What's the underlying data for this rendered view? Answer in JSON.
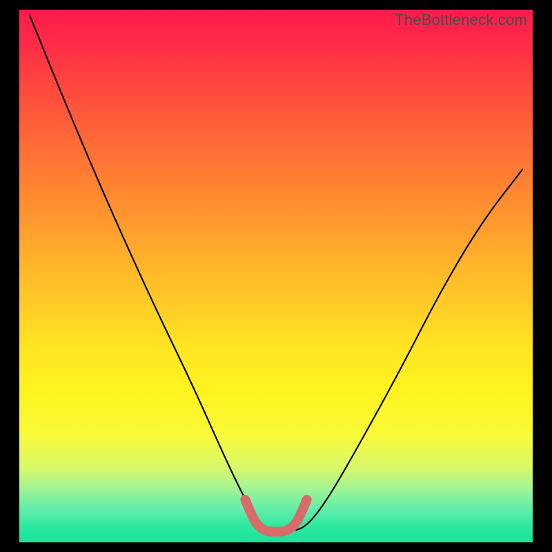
{
  "watermark": "TheBottleneck.com",
  "chart_data": {
    "type": "line",
    "title": "",
    "xlabel": "",
    "ylabel": "",
    "xlim": [
      0,
      100
    ],
    "ylim": [
      0,
      100
    ],
    "grid": false,
    "series": [
      {
        "name": "bottleneck-curve",
        "color": "#000000",
        "x": [
          2,
          10,
          18,
          26,
          34,
          40,
          44,
          47,
          50,
          53,
          56,
          60,
          66,
          74,
          82,
          90,
          98
        ],
        "values": [
          99,
          80,
          62,
          45,
          29,
          16,
          8,
          3,
          2,
          2,
          3,
          8,
          18,
          32,
          47,
          60,
          70
        ]
      },
      {
        "name": "optimal-band",
        "color": "#d96b6b",
        "x": [
          44,
          46,
          48,
          50,
          52,
          54,
          56
        ],
        "values": [
          8,
          3.5,
          2,
          2,
          2,
          3.5,
          8
        ]
      }
    ],
    "annotations": []
  }
}
